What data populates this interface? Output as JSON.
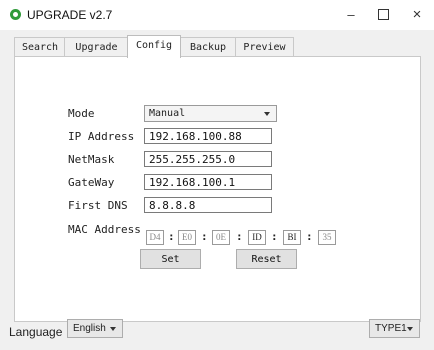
{
  "window": {
    "title": "UPGRADE v2.7",
    "icon": "app-logo-icon",
    "controls": {
      "minimize": "–",
      "close": "×"
    }
  },
  "tabs": [
    {
      "label": "Search",
      "active": false
    },
    {
      "label": "Upgrade",
      "active": false
    },
    {
      "label": "Config",
      "active": true
    },
    {
      "label": "Backup",
      "active": false
    },
    {
      "label": "Preview",
      "active": false
    }
  ],
  "config": {
    "mode": {
      "label": "Mode",
      "value": "Manual"
    },
    "ip": {
      "label": "IP Address",
      "value": "192.168.100.88"
    },
    "netmask": {
      "label": "NetMask",
      "value": "255.255.255.0"
    },
    "gateway": {
      "label": "GateWay",
      "value": "192.168.100.1"
    },
    "dns": {
      "label": "First DNS",
      "value": "8.8.8.8"
    },
    "mac": {
      "label": "MAC Address",
      "separator": ":",
      "octets": [
        "D4",
        "E0",
        "0E",
        "ID",
        "BI",
        "35"
      ]
    }
  },
  "buttons": {
    "set": "Set",
    "reset": "Reset"
  },
  "footer": {
    "language_label": "Language",
    "language_value": "English",
    "type_value": "TYPE1"
  },
  "colors": {
    "app_icon": "#2f9a3a",
    "panel_bg": "#ffffff",
    "window_bg": "#f0f0f0"
  }
}
